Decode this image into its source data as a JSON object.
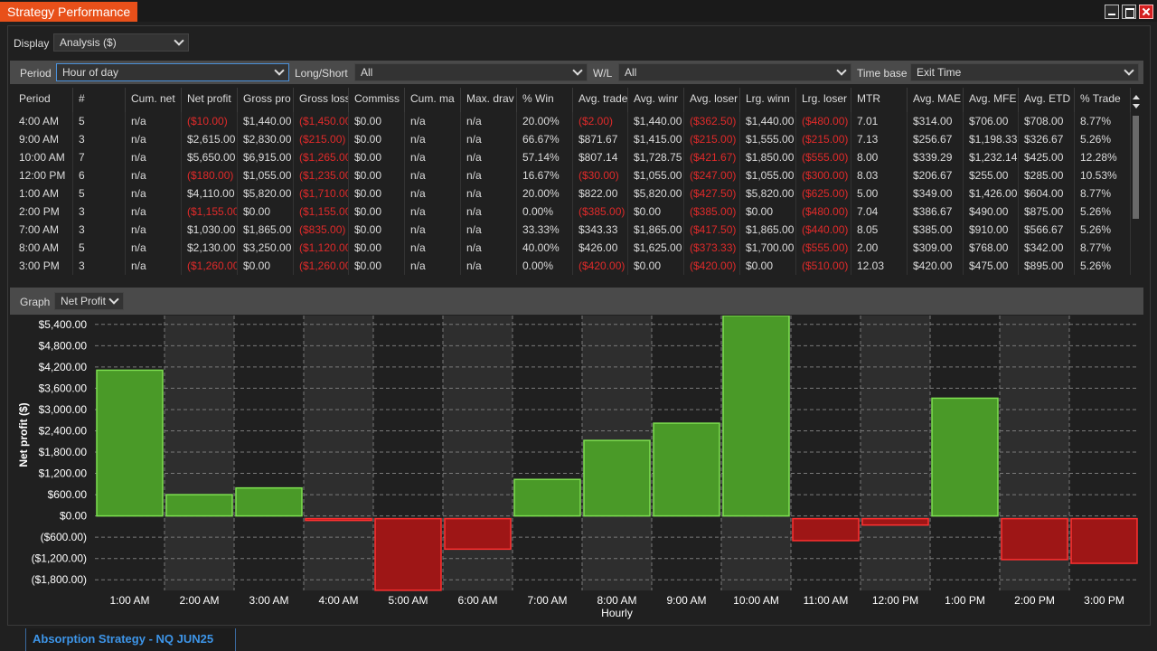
{
  "window": {
    "title": "Strategy Performance"
  },
  "display": {
    "label": "Display",
    "value": "Analysis ($)"
  },
  "filters": {
    "period_label": "Period",
    "period_value": "Hour of day",
    "longshort_label": "Long/Short",
    "longshort_value": "All",
    "wl_label": "W/L",
    "wl_value": "All",
    "timebase_label": "Time base",
    "timebase_value": "Exit Time"
  },
  "table": {
    "headers": [
      "Period",
      "#",
      "Cum. net",
      "Net profit",
      "Gross pro",
      "Gross loss",
      "Commiss",
      "Cum. ma",
      "Max. drav",
      "% Win",
      "Avg. trade",
      "Avg. winr",
      "Avg. loser",
      "Lrg. winn",
      "Lrg. loser",
      "MTR",
      "Avg. MAE",
      "Avg. MFE",
      "Avg. ETD",
      "% Trade"
    ],
    "rows": [
      [
        "4:00 AM",
        "5",
        "n/a",
        "($10.00)",
        "$1,440.00",
        "($1,450.00)",
        "$0.00",
        "n/a",
        "n/a",
        "20.00%",
        "($2.00)",
        "$1,440.00",
        "($362.50)",
        "$1,440.00",
        "($480.00)",
        "7.01",
        "$314.00",
        "$706.00",
        "$708.00",
        "8.77%"
      ],
      [
        "9:00 AM",
        "3",
        "n/a",
        "$2,615.00",
        "$2,830.00",
        "($215.00)",
        "$0.00",
        "n/a",
        "n/a",
        "66.67%",
        "$871.67",
        "$1,415.00",
        "($215.00)",
        "$1,555.00",
        "($215.00)",
        "7.13",
        "$256.67",
        "$1,198.33",
        "$326.67",
        "5.26%"
      ],
      [
        "10:00 AM",
        "7",
        "n/a",
        "$5,650.00",
        "$6,915.00",
        "($1,265.00)",
        "$0.00",
        "n/a",
        "n/a",
        "57.14%",
        "$807.14",
        "$1,728.75",
        "($421.67)",
        "$1,850.00",
        "($555.00)",
        "8.00",
        "$339.29",
        "$1,232.14",
        "$425.00",
        "12.28%"
      ],
      [
        "12:00 PM",
        "6",
        "n/a",
        "($180.00)",
        "$1,055.00",
        "($1,235.00)",
        "$0.00",
        "n/a",
        "n/a",
        "16.67%",
        "($30.00)",
        "$1,055.00",
        "($247.00)",
        "$1,055.00",
        "($300.00)",
        "8.03",
        "$206.67",
        "$255.00",
        "$285.00",
        "10.53%"
      ],
      [
        "1:00 AM",
        "5",
        "n/a",
        "$4,110.00",
        "$5,820.00",
        "($1,710.00)",
        "$0.00",
        "n/a",
        "n/a",
        "20.00%",
        "$822.00",
        "$5,820.00",
        "($427.50)",
        "$5,820.00",
        "($625.00)",
        "5.00",
        "$349.00",
        "$1,426.00",
        "$604.00",
        "8.77%"
      ],
      [
        "2:00 PM",
        "3",
        "n/a",
        "($1,155.00)",
        "$0.00",
        "($1,155.00)",
        "$0.00",
        "n/a",
        "n/a",
        "0.00%",
        "($385.00)",
        "$0.00",
        "($385.00)",
        "$0.00",
        "($480.00)",
        "7.04",
        "$386.67",
        "$490.00",
        "$875.00",
        "5.26%"
      ],
      [
        "7:00 AM",
        "3",
        "n/a",
        "$1,030.00",
        "$1,865.00",
        "($835.00)",
        "$0.00",
        "n/a",
        "n/a",
        "33.33%",
        "$343.33",
        "$1,865.00",
        "($417.50)",
        "$1,865.00",
        "($440.00)",
        "8.05",
        "$385.00",
        "$910.00",
        "$566.67",
        "5.26%"
      ],
      [
        "8:00 AM",
        "5",
        "n/a",
        "$2,130.00",
        "$3,250.00",
        "($1,120.00)",
        "$0.00",
        "n/a",
        "n/a",
        "40.00%",
        "$426.00",
        "$1,625.00",
        "($373.33)",
        "$1,700.00",
        "($555.00)",
        "2.00",
        "$309.00",
        "$768.00",
        "$342.00",
        "8.77%"
      ],
      [
        "3:00 PM",
        "3",
        "n/a",
        "($1,260.00)",
        "$0.00",
        "($1,260.00)",
        "$0.00",
        "n/a",
        "n/a",
        "0.00%",
        "($420.00)",
        "$0.00",
        "($420.00)",
        "$0.00",
        "($510.00)",
        "12.03",
        "$420.00",
        "$475.00",
        "$895.00",
        "5.26%"
      ]
    ]
  },
  "graph": {
    "label": "Graph",
    "value": "Net Profit"
  },
  "chart_data": {
    "type": "bar",
    "categories": [
      "1:00 AM",
      "2:00 AM",
      "3:00 AM",
      "4:00 AM",
      "5:00 AM",
      "6:00 AM",
      "7:00 AM",
      "8:00 AM",
      "9:00 AM",
      "10:00 AM",
      "11:00 AM",
      "12:00 PM",
      "1:00 PM",
      "2:00 PM",
      "3:00 PM"
    ],
    "values": [
      4110,
      600,
      790,
      -10,
      -2020,
      -860,
      1030,
      2130,
      2615,
      5650,
      -620,
      -180,
      3320,
      -1155,
      -1260
    ],
    "yticks": [
      5400,
      4800,
      4200,
      3600,
      3000,
      2400,
      1800,
      1200,
      600,
      0,
      -600,
      -1200,
      -1800
    ],
    "ytick_labels": [
      "$5,400.00",
      "$4,800.00",
      "$4,200.00",
      "$3,600.00",
      "$3,000.00",
      "$2,400.00",
      "$1,800.00",
      "$1,200.00",
      "$600.00",
      "$0.00",
      "($600.00)",
      "($1,200.00)",
      "($1,800.00)"
    ],
    "ylim": [
      -2100,
      5650
    ],
    "xlabel": "Hourly",
    "ylabel": "Net profit ($)",
    "grid": true,
    "colors": {
      "positive": "#4a9a28",
      "positive_edge": "#7ee050",
      "negative": "#9e1616",
      "negative_edge": "#ff3030",
      "band": "#2e2e2e"
    }
  },
  "footer": {
    "tab": "Absorption Strategy - NQ JUN25"
  }
}
